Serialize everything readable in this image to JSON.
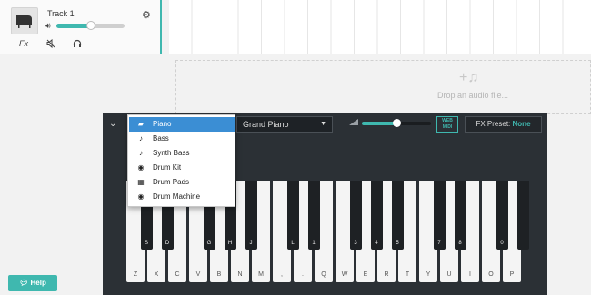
{
  "colors": {
    "accent": "#3fb8af",
    "panel": "#2b3035",
    "selected": "#3b8ed4"
  },
  "track": {
    "name": "Track 1",
    "volume": 0.5,
    "icons": {
      "thumbnail": "grand-piano-icon",
      "settings": "gear-icon",
      "volume": "speaker-icon",
      "fx": "fx-icon",
      "mute": "mute-icon",
      "monitor": "headphones-icon"
    },
    "fx_label": "Fx"
  },
  "drop_zone": {
    "text": "Drop an audio file...",
    "icon": "add-music-icon"
  },
  "keyboard": {
    "instrument": "Grand Piano",
    "volume": 0.5,
    "webmidi_label_top": "WEB",
    "webmidi_label_bottom": "MIDI",
    "fx_preset_label": "FX Preset:",
    "fx_preset_value": "None",
    "white_keys": [
      "Z",
      "X",
      "C",
      "V",
      "B",
      "N",
      "M",
      ",",
      ".",
      "Q",
      "W",
      "E",
      "R",
      "T",
      "Y",
      "U",
      "I",
      "O",
      "P"
    ],
    "black_keys": [
      {
        "after": 0,
        "label": "S"
      },
      {
        "after": 1,
        "label": "D"
      },
      {
        "after": 3,
        "label": "G"
      },
      {
        "after": 4,
        "label": "H"
      },
      {
        "after": 5,
        "label": "J"
      },
      {
        "after": 7,
        "label": "L"
      },
      {
        "after": 8,
        "label": "1"
      },
      {
        "after": 10,
        "label": "3"
      },
      {
        "after": 11,
        "label": "4"
      },
      {
        "after": 12,
        "label": "5"
      },
      {
        "after": 14,
        "label": "7"
      },
      {
        "after": 15,
        "label": "8"
      },
      {
        "after": 17,
        "label": "0"
      },
      {
        "after": 18,
        "label": ""
      }
    ]
  },
  "instrument_menu": [
    {
      "label": "Piano",
      "icon": "piano-icon",
      "selected": true
    },
    {
      "label": "Bass",
      "icon": "bass-icon",
      "selected": false
    },
    {
      "label": "Synth Bass",
      "icon": "synth-bass-icon",
      "selected": false
    },
    {
      "label": "Drum Kit",
      "icon": "drum-kit-icon",
      "selected": false
    },
    {
      "label": "Drum Pads",
      "icon": "drum-pads-icon",
      "selected": false
    },
    {
      "label": "Drum Machine",
      "icon": "drum-machine-icon",
      "selected": false
    }
  ],
  "help": {
    "label": "Help",
    "icon": "chat-icon"
  }
}
